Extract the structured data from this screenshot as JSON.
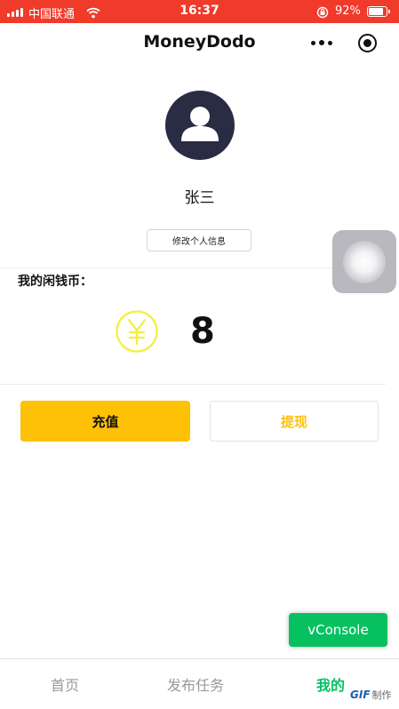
{
  "status_bar": {
    "carrier": "中国联通",
    "time": "16:37",
    "battery_text": "92%",
    "battery_level": 0.92,
    "background": "#f03a2a"
  },
  "nav": {
    "title": "MoneyDodo",
    "icons": [
      "more-icon",
      "target-icon"
    ]
  },
  "profile": {
    "name": "张三",
    "avatar_icon": "user-icon",
    "avatar_color": "#2a2c44",
    "edit_button": "修改个人信息"
  },
  "wallet": {
    "label": "我的闲钱币：",
    "icon": "yuan-icon",
    "icon_color": "#f5ee3a",
    "value": "8"
  },
  "actions": {
    "recharge": "充值",
    "withdraw": "提现",
    "accent": "#ffc107"
  },
  "vconsole": {
    "label": "vConsole",
    "color": "#07c160"
  },
  "tabbar": {
    "tabs": [
      {
        "label": "首页",
        "active": false
      },
      {
        "label": "发布任务",
        "active": false
      },
      {
        "label": "我的",
        "active": true
      }
    ],
    "active_color": "#07c160"
  },
  "watermark": {
    "logo": "GIF",
    "text": "制作"
  }
}
